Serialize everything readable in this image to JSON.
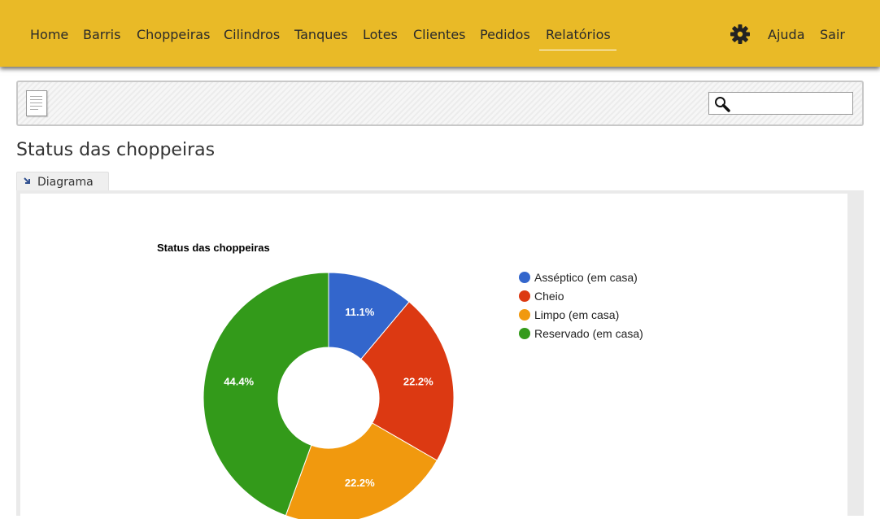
{
  "nav": {
    "items": [
      {
        "label": "Home"
      },
      {
        "label": "Barris"
      },
      {
        "label": "Choppeiras"
      },
      {
        "label": "Cilindros"
      },
      {
        "label": "Tanques"
      },
      {
        "label": "Lotes"
      },
      {
        "label": "Clientes"
      },
      {
        "label": "Pedidos"
      },
      {
        "label": "Relatórios"
      }
    ],
    "active": "Relatórios",
    "right": {
      "help": "Ajuda",
      "logout": "Sair"
    }
  },
  "toolbar": {
    "search_value": ""
  },
  "page": {
    "title": "Status das choppeiras"
  },
  "tab": {
    "label": "Diagrama"
  },
  "chart_data": {
    "type": "pie",
    "donut": true,
    "title": "Status das choppeiras",
    "labels": [
      "Asséptico (em casa)",
      "Cheio",
      "Limpo (em casa)",
      "Reservado (em casa)"
    ],
    "values": [
      11.1,
      22.2,
      22.2,
      44.4
    ],
    "value_labels": [
      "11.1%",
      "22.2%",
      "22.2%",
      "44.4%"
    ],
    "colors": [
      "#3366cc",
      "#dc3912",
      "#f1990e",
      "#339a1a"
    ],
    "legend_position": "right"
  },
  "colors": {
    "topbar": "#e9ba27"
  }
}
